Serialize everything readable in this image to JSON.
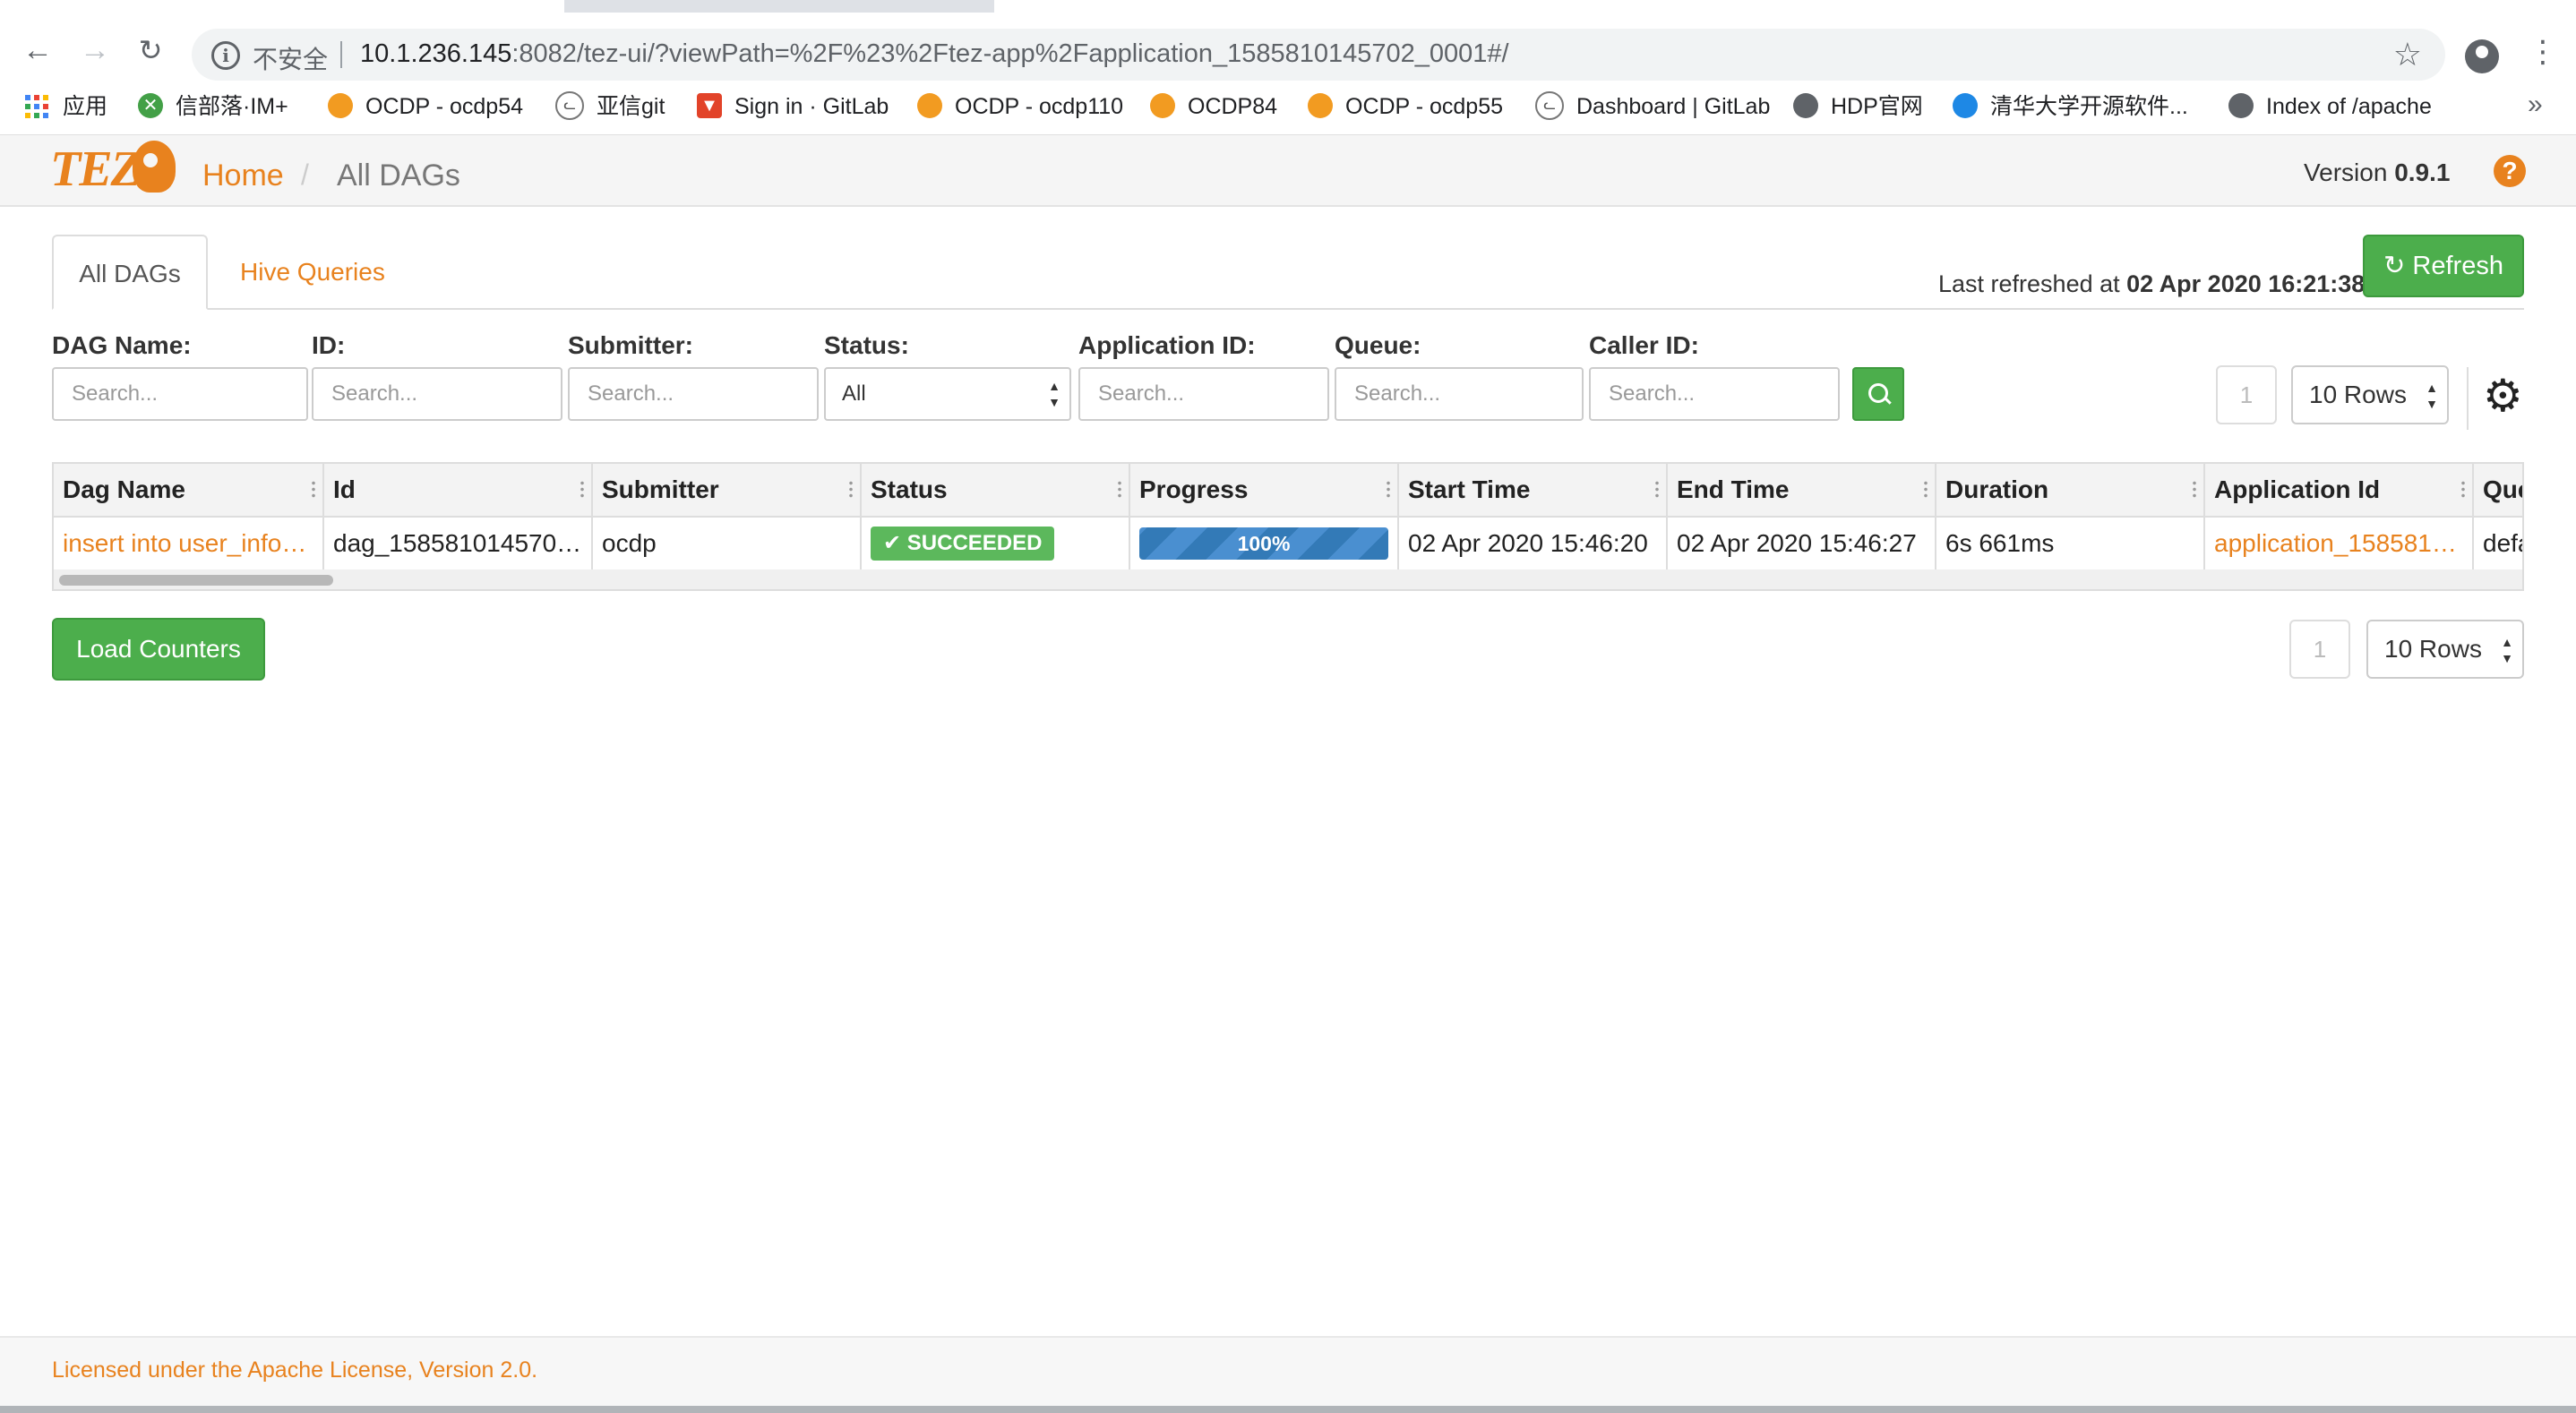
{
  "browser": {
    "insecure_label": "不安全",
    "url_host": "10.1.236.145",
    "url_rest": ":8082/tez-ui/?viewPath=%2F%23%2Ftez-app%2Fapplication_1585810145702_0001#/"
  },
  "bookmarks": [
    {
      "label": "应用",
      "icon": "apps-grid-icon"
    },
    {
      "label": "信部落·IM+",
      "icon": "im-plus-icon"
    },
    {
      "label": "OCDP - ocdp54",
      "icon": "ocdp-cloud-icon"
    },
    {
      "label": "亚信git",
      "icon": "gitea-cat-icon"
    },
    {
      "label": "Sign in · GitLab",
      "icon": "gitlab-icon"
    },
    {
      "label": "OCDP - ocdp110",
      "icon": "ocdp-cloud-icon"
    },
    {
      "label": "OCDP84",
      "icon": "ocdp-cloud-icon"
    },
    {
      "label": "OCDP - ocdp55",
      "icon": "ocdp-cloud-icon"
    },
    {
      "label": "Dashboard | GitLab",
      "icon": "gitea-cat-icon"
    },
    {
      "label": "HDP官网",
      "icon": "globe-icon"
    },
    {
      "label": "清华大学开源软件...",
      "icon": "tuna-bird-icon"
    },
    {
      "label": "Index of /apache",
      "icon": "globe-icon"
    }
  ],
  "header": {
    "logo_text": "TEZ",
    "breadcrumb_home": "Home",
    "breadcrumb_sep": "/",
    "breadcrumb_current": "All DAGs",
    "version_label": "Version",
    "version_number": "0.9.1",
    "help_glyph": "?"
  },
  "tabs": [
    {
      "label": "All DAGs",
      "active": true
    },
    {
      "label": "Hive Queries",
      "active": false
    }
  ],
  "refresh": {
    "last_refreshed_label": "Last refreshed at",
    "last_refreshed_time": "02 Apr 2020 16:21:38",
    "button_label": "Refresh"
  },
  "filters": {
    "dag_name": {
      "label": "DAG Name:",
      "placeholder": "Search..."
    },
    "id": {
      "label": "ID:",
      "placeholder": "Search..."
    },
    "submitter": {
      "label": "Submitter:",
      "placeholder": "Search..."
    },
    "status": {
      "label": "Status:",
      "selected": "All"
    },
    "application_id": {
      "label": "Application ID:",
      "placeholder": "Search..."
    },
    "queue": {
      "label": "Queue:",
      "placeholder": "Search..."
    },
    "caller_id": {
      "label": "Caller ID:",
      "placeholder": "Search..."
    }
  },
  "pagination_top": {
    "page": "1",
    "rows": "10 Rows"
  },
  "pagination_bottom": {
    "page": "1",
    "rows": "10 Rows"
  },
  "table": {
    "columns": [
      "Dag Name",
      "Id",
      "Submitter",
      "Status",
      "Progress",
      "Start Time",
      "End Time",
      "Duration",
      "Application Id",
      "Queue"
    ],
    "rows": [
      {
        "dag_name": "insert into user_info…",
        "id": "dag_158581014570…",
        "submitter": "ocdp",
        "status": "SUCCEEDED",
        "progress_label": "100%",
        "progress_fraction": 1.0,
        "start_time": "02 Apr 2020 15:46:20",
        "end_time": "02 Apr 2020 15:46:27",
        "duration": "6s 661ms",
        "application_id": "application_158581…",
        "queue": "default"
      }
    ]
  },
  "load_counters_label": "Load Counters",
  "footer_text": "Licensed under the Apache License, Version 2.0.",
  "colors": {
    "accent": "#e8821e",
    "success": "#5cb85c",
    "progress": "#337ab7"
  }
}
